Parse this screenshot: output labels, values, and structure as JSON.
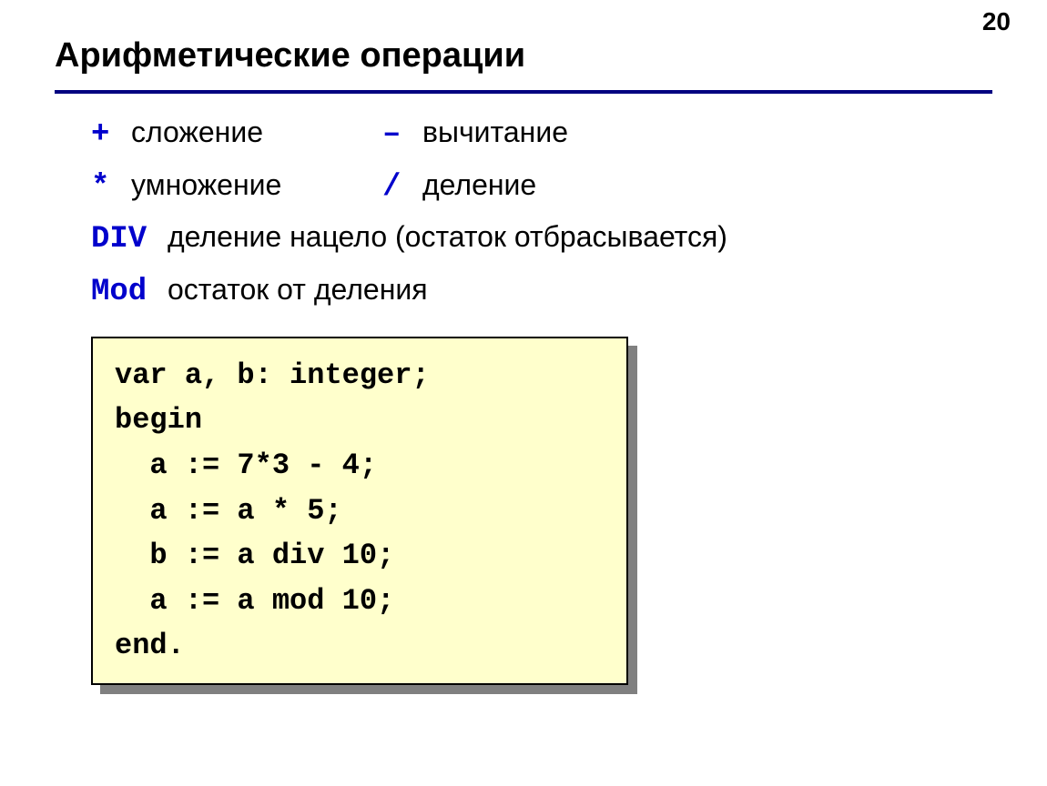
{
  "page_number": "20",
  "title": "Арифметические операции",
  "ops": {
    "plus": {
      "symbol": "+",
      "label": "сложение"
    },
    "minus": {
      "symbol": "–",
      "label": "вычитание"
    },
    "times": {
      "symbol": "*",
      "label": "умножение"
    },
    "divide": {
      "symbol": "/",
      "label": "деление"
    },
    "div": {
      "symbol": "DIV",
      "label": "деление нацело (остаток отбрасывается)"
    },
    "mod": {
      "symbol": "Mod",
      "label": "остаток от деления"
    }
  },
  "code": "var a, b: integer;\nbegin\n  a := 7*3 - 4;\n  a := a * 5;\n  b := a div 10;\n  a := a mod 10;\nend."
}
